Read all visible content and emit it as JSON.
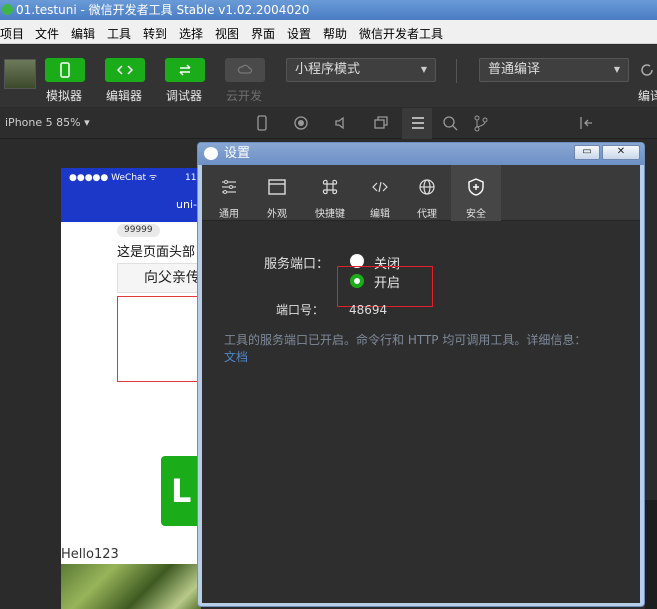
{
  "window": {
    "title": "01.testuni - 微信开发者工具 Stable v1.02.2004020"
  },
  "menu": [
    "项目",
    "文件",
    "编辑",
    "工具",
    "转到",
    "选择",
    "视图",
    "界面",
    "设置",
    "帮助",
    "微信开发者工具"
  ],
  "toolbar": {
    "simulator": "模拟器",
    "editor": "编辑器",
    "debugger": "调试器",
    "cloud": "云开发",
    "mode_select": "小程序模式",
    "compile_select": "普通编译",
    "compile_partial": "编译"
  },
  "subbar": {
    "device": "iPhone 5 85% ▾"
  },
  "simulator": {
    "status": "●●●●● WeChat ᯤ",
    "time": "11",
    "nav_title": "uni-",
    "badge": "99999",
    "header_text": "这是页面头部",
    "parent_button": "向父亲传",
    "hello": "Hello123"
  },
  "dialog": {
    "title": "设置",
    "minimize": "▭",
    "close": "✕",
    "tabs": [
      {
        "label": "通用",
        "icon": "sliders-icon"
      },
      {
        "label": "外观",
        "icon": "window-icon"
      },
      {
        "label": "快捷键",
        "icon": "command-icon"
      },
      {
        "label": "编辑",
        "icon": "code-icon"
      },
      {
        "label": "代理",
        "icon": "globe-icon"
      },
      {
        "label": "安全",
        "icon": "shield-icon"
      }
    ],
    "active_tab": "安全",
    "service_port_label": "服务端口：",
    "option_off": "关闭",
    "option_on": "开启",
    "selected_option": "开启",
    "port_label": "端口号：",
    "port_value": "48694",
    "info": "工具的服务端口已开启。命令行和 HTTP 均可调用工具。详细信息：",
    "doc_link": "文档"
  },
  "colors": {
    "accent": "#1aad19",
    "nav_blue": "#1b38c9",
    "annotation_red": "#e0202a",
    "link": "#4e86c9"
  }
}
